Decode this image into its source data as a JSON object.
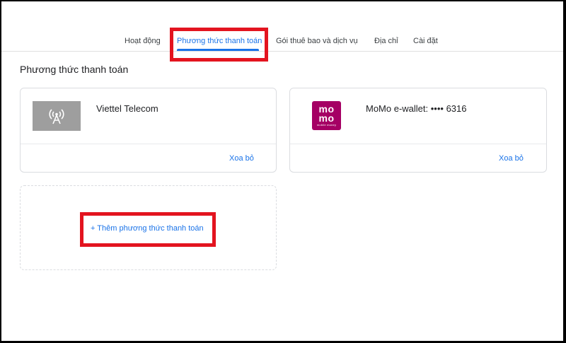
{
  "tabs": [
    {
      "label": "Hoạt động",
      "active": false
    },
    {
      "label": "Phương thức thanh toán",
      "active": true
    },
    {
      "label": "Gói thuê bao và dịch vụ",
      "active": false
    },
    {
      "label": "Địa chỉ",
      "active": false
    },
    {
      "label": "Cài đặt",
      "active": false
    }
  ],
  "section": {
    "title": "Phương thức thanh toán"
  },
  "payment_methods": [
    {
      "name": "Viettel Telecom",
      "logo": "cell-tower-icon",
      "remove_label": "Xoa bỏ"
    },
    {
      "name": "MoMo e-wallet: •••• 6316",
      "logo": "momo-logo",
      "logo_text": "mo",
      "logo_subtext": "mobile money",
      "remove_label": "Xoa bỏ"
    }
  ],
  "add_method": {
    "label": "+  Thêm phương thức thanh toán"
  },
  "colors": {
    "accent": "#1a73e8",
    "highlight": "#e3141f",
    "momo": "#a50064",
    "viettel_logo_bg": "#9e9e9e"
  }
}
